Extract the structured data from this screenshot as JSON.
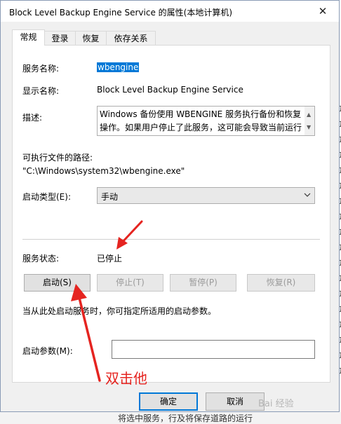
{
  "window": {
    "title": "Block Level Backup Engine Service 的属性(本地计算机)",
    "close_glyph": "✕"
  },
  "tabs": [
    {
      "label": "常规"
    },
    {
      "label": "登录"
    },
    {
      "label": "恢复"
    },
    {
      "label": "依存关系"
    }
  ],
  "general": {
    "service_name_label": "服务名称:",
    "service_name": "wbengine",
    "display_name_label": "显示名称:",
    "display_name": "Block Level Backup Engine Service",
    "description_label": "描述:",
    "description": "Windows 备份使用 WBENGINE 服务执行备份和恢复操作。如果用户停止了此服务，这可能会导致当前运行",
    "exe_path_label": "可执行文件的路径:",
    "exe_path": "\"C:\\Windows\\system32\\wbengine.exe\"",
    "startup_type_label": "启动类型(E):",
    "startup_type": "手动",
    "status_label": "服务状态:",
    "status": "已停止",
    "buttons": {
      "start": "启动(S)",
      "stop": "停止(T)",
      "pause": "暂停(P)",
      "resume": "恢复(R)"
    },
    "hint": "当从此处启动服务时，你可指定所适用的启动参数。",
    "start_params_label": "启动参数(M):",
    "start_params_value": ""
  },
  "footer": {
    "ok": "确定",
    "cancel": "取消"
  },
  "annotation": {
    "text": "双击他",
    "color": "#e52420"
  },
  "watermark": "Bai 经验",
  "background": {
    "bottom_text": "将选中服务，行及将保存道路的运行"
  }
}
